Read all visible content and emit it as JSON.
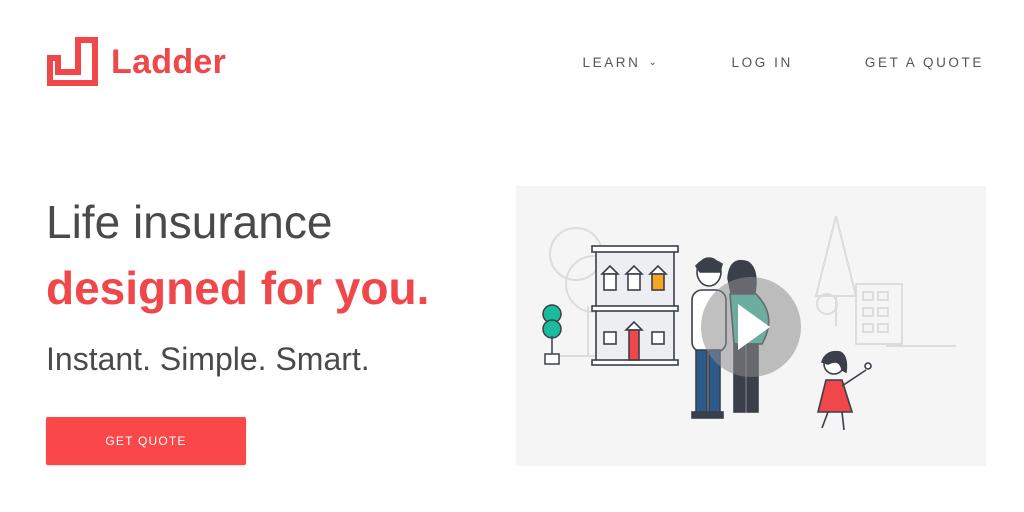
{
  "header": {
    "logo_text": "Ladder",
    "nav": {
      "learn": "LEARN",
      "login": "LOG IN",
      "quote": "GET A QUOTE"
    }
  },
  "hero": {
    "headline_line1": "Life insurance",
    "headline_line2": "designed for you.",
    "subline": "Instant. Simple. Smart.",
    "cta_label": "GET QUOTE"
  },
  "colors": {
    "brand": "#f0474a",
    "text": "#4a4a4a",
    "video_bg": "#f5f5f5"
  },
  "icons": [
    "ladder-logo-icon",
    "chevron-down-icon",
    "play-icon"
  ]
}
